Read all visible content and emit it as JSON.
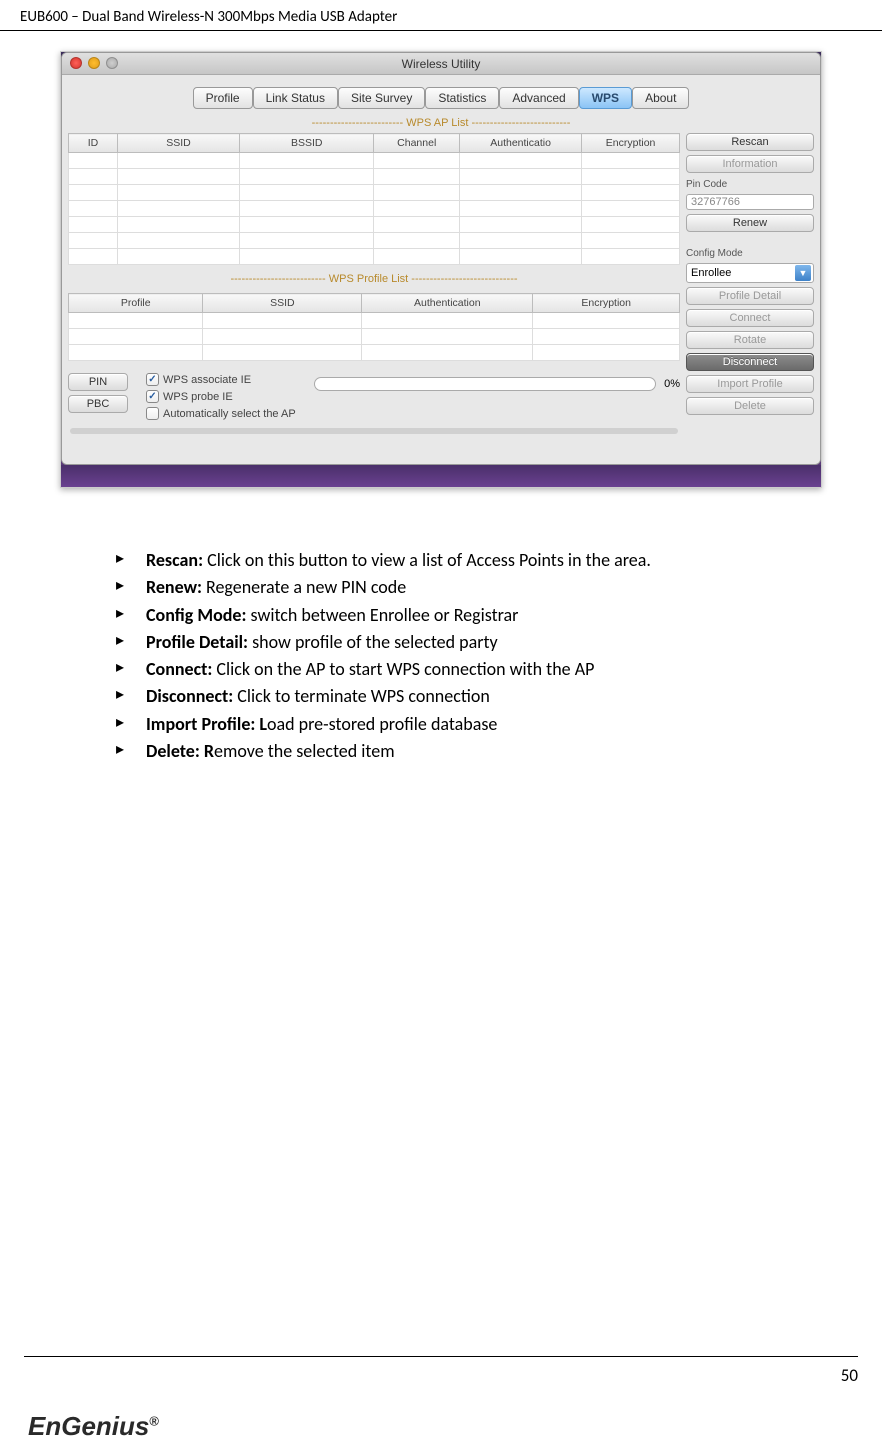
{
  "header": {
    "title": "EUB600 – Dual Band Wireless-N 300Mbps Media USB Adapter"
  },
  "window": {
    "title": "Wireless Utility",
    "tabs": [
      "Profile",
      "Link Status",
      "Site Survey",
      "Statistics",
      "Advanced",
      "WPS",
      "About"
    ],
    "active_tab": "WPS",
    "ap_list": {
      "title": "------------------------- WPS AP List ---------------------------",
      "cols": [
        "ID",
        "SSID",
        "BSSID",
        "Channel",
        "Authenticatio",
        "Encryption"
      ]
    },
    "profile_list": {
      "title": "-------------------------- WPS Profile List -----------------------------",
      "cols": [
        "Profile",
        "SSID",
        "Authentication",
        "Encryption"
      ]
    },
    "side": {
      "rescan": "Rescan",
      "information": "Information",
      "pin_label": "Pin Code",
      "pin_value": "32767766",
      "renew": "Renew",
      "config_label": "Config Mode",
      "config_value": "Enrollee",
      "profile_detail": "Profile Detail",
      "connect": "Connect",
      "rotate": "Rotate",
      "disconnect": "Disconnect",
      "import_profile": "Import Profile",
      "delete": "Delete"
    },
    "bottom": {
      "pin_btn": "PIN",
      "pbc_btn": "PBC",
      "check1": "WPS associate IE",
      "check2": "WPS probe IE",
      "check3": "Automatically select the AP",
      "progress": "0%"
    }
  },
  "doc": {
    "items": [
      {
        "term": "Rescan:",
        "desc": " Click on this button to view a list of Access Points in the area."
      },
      {
        "term": "Renew:",
        "desc": " Regenerate a new PIN code"
      },
      {
        "term": "Config Mode:",
        "desc": " switch between Enrollee or Registrar"
      },
      {
        "term": "Profile Detail:",
        "desc": " show profile of the selected party"
      },
      {
        "term": "Connect:",
        "desc": " Click on the AP to start WPS connection with the AP"
      },
      {
        "term": "Disconnect:",
        "desc": " Click to terminate WPS connection"
      },
      {
        "term": "Import Profile: L",
        "desc": "oad pre-stored profile database"
      },
      {
        "term": "Delete: R",
        "desc": "emove the selected item"
      }
    ]
  },
  "footer": {
    "page": "50",
    "logo": "EnGenius",
    "reg": "®"
  }
}
